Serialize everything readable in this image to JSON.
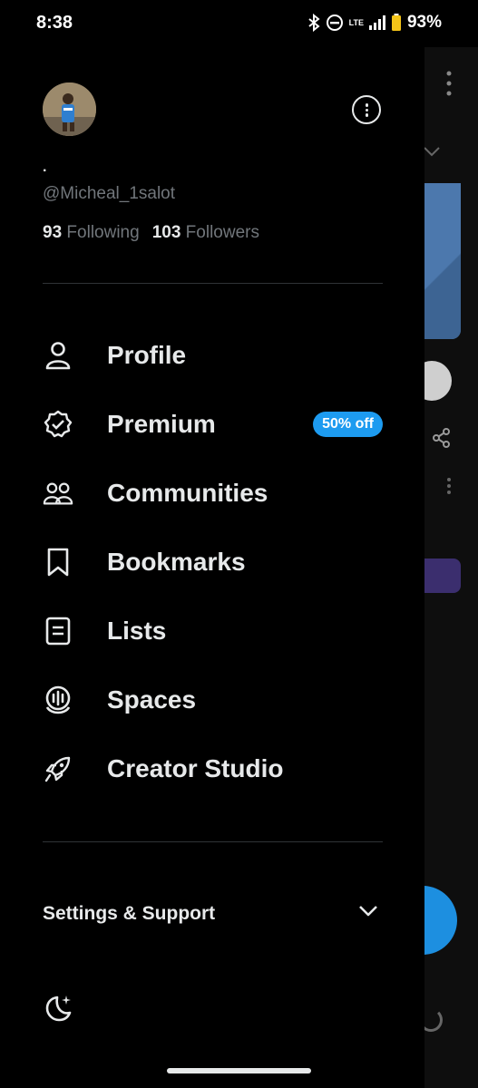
{
  "status_bar": {
    "time": "8:38",
    "network": "LTE",
    "battery": "93%"
  },
  "profile": {
    "display_name": ".",
    "handle": "@Micheal_1salot",
    "following_count": "93",
    "following_label": "Following",
    "followers_count": "103",
    "followers_label": "Followers"
  },
  "menu": {
    "items": [
      {
        "label": "Profile",
        "icon": "person-icon"
      },
      {
        "label": "Premium",
        "icon": "verified-badge-icon",
        "badge": "50% off"
      },
      {
        "label": "Communities",
        "icon": "communities-icon"
      },
      {
        "label": "Bookmarks",
        "icon": "bookmark-icon"
      },
      {
        "label": "Lists",
        "icon": "list-icon"
      },
      {
        "label": "Spaces",
        "icon": "spaces-icon"
      },
      {
        "label": "Creator Studio",
        "icon": "rocket-icon"
      }
    ]
  },
  "settings": {
    "label": "Settings & Support"
  },
  "colors": {
    "background": "#000000",
    "text": "#e7e9ea",
    "secondary_text": "#71767b",
    "accent": "#1d9bf0",
    "divider": "#2f3336"
  }
}
